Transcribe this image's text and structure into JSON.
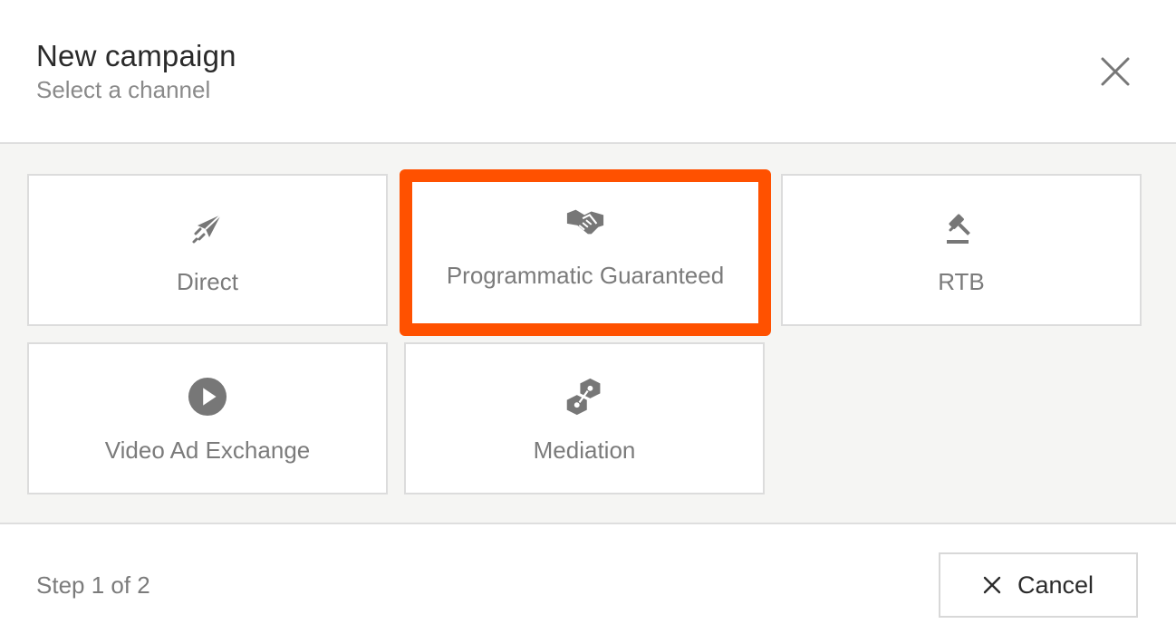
{
  "header": {
    "title": "New campaign",
    "subtitle": "Select a channel",
    "close_icon": "close-icon"
  },
  "channels": [
    {
      "label": "Direct",
      "icon": "paper-plane-icon",
      "selected": false
    },
    {
      "label": "Programmatic Guaranteed",
      "icon": "handshake-icon",
      "selected": true
    },
    {
      "label": "RTB",
      "icon": "gavel-icon",
      "selected": false
    },
    {
      "label": "Video Ad Exchange",
      "icon": "play-circle-icon",
      "selected": false
    },
    {
      "label": "Mediation",
      "icon": "linked-hexagons-icon",
      "selected": false
    }
  ],
  "footer": {
    "step": "Step 1 of 2",
    "cancel_label": "Cancel",
    "cancel_icon": "close-icon"
  },
  "colors": {
    "highlight": "#ff5100",
    "icon": "#777777",
    "panel_bg": "#f5f5f3"
  }
}
